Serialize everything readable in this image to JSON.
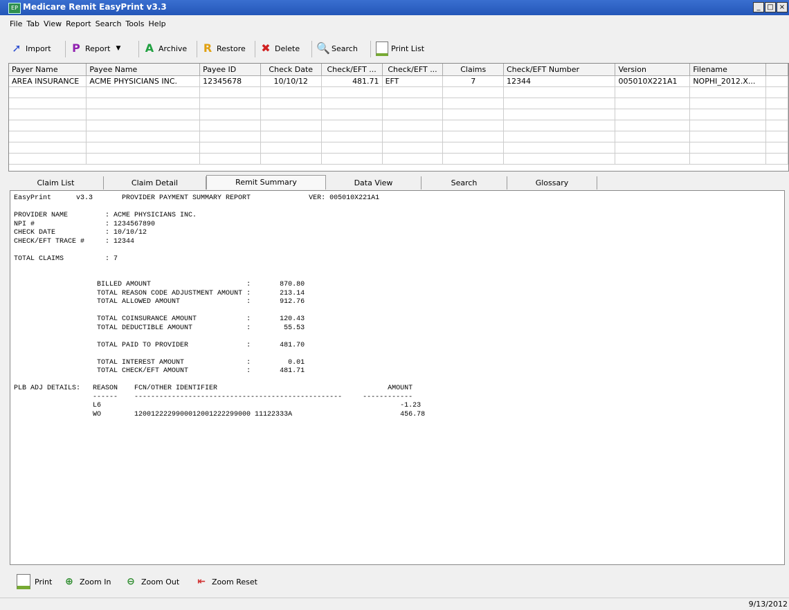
{
  "window": {
    "title": "Medicare Remit EasyPrint v3.3",
    "min": "_",
    "max": "□",
    "close": "×"
  },
  "menu": [
    "File",
    "Tab",
    "View",
    "Report",
    "Search",
    "Tools",
    "Help"
  ],
  "toolbar": {
    "import": "Import",
    "report": "Report",
    "archive": "Archive",
    "restore": "Restore",
    "delete": "Delete",
    "search": "Search",
    "print_list": "Print List"
  },
  "grid": {
    "columns": [
      "Payer Name",
      "Payee Name",
      "Payee ID",
      "Check Date",
      "Check/EFT ...",
      "Check/EFT ...",
      "Claims",
      "Check/EFT Number",
      "Version",
      "Filename"
    ],
    "rows": [
      [
        "AREA INSURANCE",
        "ACME PHYSICIANS INC.",
        "12345678",
        "10/10/12",
        "481.71",
        "EFT",
        "7",
        "12344",
        "005010X221A1",
        "NOPHI_2012.X..."
      ]
    ]
  },
  "tabs": [
    "Claim List",
    "Claim Detail",
    "Remit Summary",
    "Data View",
    "Search",
    "Glossary"
  ],
  "active_tab": "Remit Summary",
  "report": {
    "header": "EasyPrint      v3.3       PROVIDER PAYMENT SUMMARY REPORT              VER: 005010X221A1",
    "provider_lines": [
      "PROVIDER NAME         : ACME PHYSICIANS INC.",
      "NPI #                 : 1234567890",
      "CHECK DATE            : 10/10/12",
      "CHECK/EFT TRACE #     : 12344"
    ],
    "total_claims": "TOTAL CLAIMS          : 7",
    "amount_blocks": [
      [
        "BILLED AMOUNT                       :       870.80",
        "TOTAL REASON CODE ADJUSTMENT AMOUNT :       213.14",
        "TOTAL ALLOWED AMOUNT                :       912.76"
      ],
      [
        "TOTAL COINSURANCE AMOUNT            :       120.43",
        "TOTAL DEDUCTIBLE AMOUNT             :        55.53"
      ],
      [
        "TOTAL PAID TO PROVIDER              :       481.70"
      ],
      [
        "TOTAL INTEREST AMOUNT               :         0.01",
        "TOTAL CHECK/EFT AMOUNT              :       481.71"
      ]
    ],
    "plb_header": "PLB ADJ DETAILS:   REASON    FCN/OTHER IDENTIFIER                                         AMOUNT",
    "plb_rule": "                   ------    --------------------------------------------------     ------------",
    "plb_rows": [
      "                   L6                                                                        -1.23",
      "                   WO        1200122229900012001222299000 11122333A                          456.78"
    ]
  },
  "bottom_toolbar": {
    "print": "Print",
    "zoom_in": "Zoom In",
    "zoom_out": "Zoom Out",
    "zoom_reset": "Zoom Reset"
  },
  "status": {
    "date": "9/13/2012"
  }
}
